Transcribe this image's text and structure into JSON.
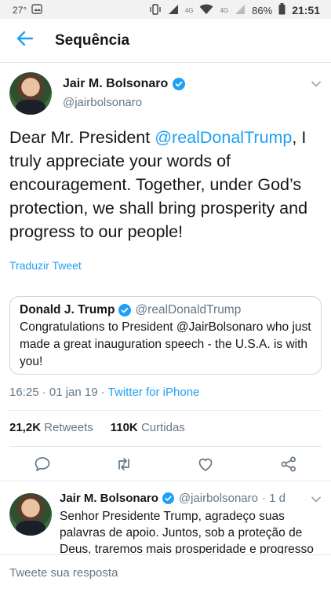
{
  "status_bar": {
    "temperature": "27°",
    "network_4g": "4G",
    "network_4g_2": "4G",
    "battery": "86%",
    "time": "21:51"
  },
  "header": {
    "title": "Sequência"
  },
  "main_tweet": {
    "author_name": "Jair M. Bolsonaro",
    "author_handle": "@jairbolsonaro",
    "text_before": "Dear Mr. President ",
    "mention": "@realDonalTrump",
    "text_after": ", I truly appreciate your words of encouragement. Together, under God’s protection, we shall bring prosperity and progress to our people!",
    "translate_label": "Traduzir Tweet",
    "quoted": {
      "name": "Donald J. Trump",
      "handle": "@realDonaldTrump",
      "text": "Congratulations to President @JairBolsonaro who just made a great inauguration speech - the U.S.A. is with you!"
    },
    "meta": {
      "time_date": "16:25 · 01 jan 19 · ",
      "source": "Twitter for iPhone"
    },
    "stats": {
      "retweets_count": "21,2K",
      "retweets_label": "Retweets",
      "likes_count": "110K",
      "likes_label": "Curtidas"
    }
  },
  "reply_tweet": {
    "author_name": "Jair M. Bolsonaro",
    "author_handle": "@jairbolsonaro",
    "time": "· 1 d",
    "text": "Senhor Presidente Trump, agradeço suas palavras de apoio. Juntos, sob a proteção de Deus, traremos mais prosperidade e progresso"
  },
  "compose": {
    "placeholder": "Tweete sua resposta"
  },
  "colors": {
    "accent": "#1da1f2",
    "text": "#14171a",
    "muted": "#657786",
    "border": "#e1e8ed"
  }
}
